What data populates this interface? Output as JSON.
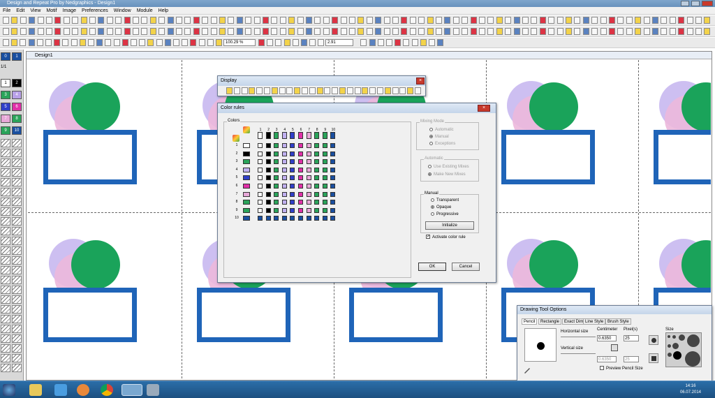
{
  "app": {
    "title": "Design and Repeat Pro by Nedgraphics - Design1"
  },
  "menu": [
    "File",
    "Edit",
    "View",
    "Motif",
    "Image",
    "Preferences",
    "Window",
    "Module",
    "Help"
  ],
  "toolbar": {
    "zoom": "100.29 %",
    "value": "2.91"
  },
  "palette": {
    "page_label": "1/1",
    "chips": [
      {
        "num": "0",
        "color": "#1a4fa0"
      },
      {
        "num": "1",
        "color": "#1a4fa0"
      },
      {
        "num": "1",
        "color": "#ffffff"
      },
      {
        "num": "2",
        "color": "#000000"
      },
      {
        "num": "3",
        "color": "#2aa45a"
      },
      {
        "num": "4",
        "color": "#b8a0e8"
      },
      {
        "num": "5",
        "color": "#3040c8"
      },
      {
        "num": "6",
        "color": "#e030a8"
      },
      {
        "num": "7",
        "color": "#e8a8d8"
      },
      {
        "num": "8",
        "color": "#2aa45a"
      },
      {
        "num": "9",
        "color": "#2aa45a"
      },
      {
        "num": "10",
        "color": "#1a4fa0"
      }
    ]
  },
  "document": {
    "title": "Design1"
  },
  "motif_colors": {
    "lilac": "#c8b8f0",
    "pink": "#ecb8dc",
    "green": "#1aa35a",
    "blue": "#1f64b8"
  },
  "display_window": {
    "title": "Display"
  },
  "color_rules": {
    "title": "Color rules",
    "colors_label": "Colors",
    "col_numbers": [
      "1",
      "2",
      "3",
      "4",
      "5",
      "6",
      "7",
      "8",
      "9",
      "10"
    ],
    "row_numbers": [
      "1",
      "2",
      "3",
      "4",
      "5",
      "6",
      "7",
      "8",
      "9",
      "10"
    ],
    "palette": [
      "#ffffff",
      "#000000",
      "#2aa45a",
      "#c0b0f0",
      "#3040c8",
      "#e030a8",
      "#e8a8d8",
      "#2aa45a",
      "#2aa45a",
      "#1a4fa0"
    ],
    "mixing_mode": {
      "label": "Mixing Mode",
      "options": [
        "Automatic",
        "Manual",
        "Exceptions"
      ],
      "selected": "Manual"
    },
    "automatic": {
      "label": "Automatic",
      "options": [
        "Use Existing Mixes",
        "Make New Mixes"
      ]
    },
    "manual": {
      "label": "Manual",
      "options": [
        "Transparent",
        "Opaque",
        "Progressive"
      ],
      "selected": "Opaque",
      "initialize_label": "Initialize"
    },
    "activate_label": "Activate color rule",
    "ok_label": "OK",
    "cancel_label": "Cancel"
  },
  "drawing_tool_options": {
    "title": "Drawing Tool Options",
    "tabs": [
      "Pencil",
      "Rectangle",
      "Exact Dim",
      "Line Style",
      "Brush Style"
    ],
    "horizontal_label": "Horizontal size",
    "vertical_label": "Vertical size",
    "centimeter_label": "Centimeter",
    "pixels_label": "Pixel(s)",
    "size_label": "Size",
    "h_cm": "0.6350",
    "h_px": "25",
    "v_cm": "0.6350",
    "v_px": "25",
    "preview_label": "Preview Pencil Size"
  },
  "taskbar": {
    "time": "14:16",
    "date": "06.07.2014"
  }
}
